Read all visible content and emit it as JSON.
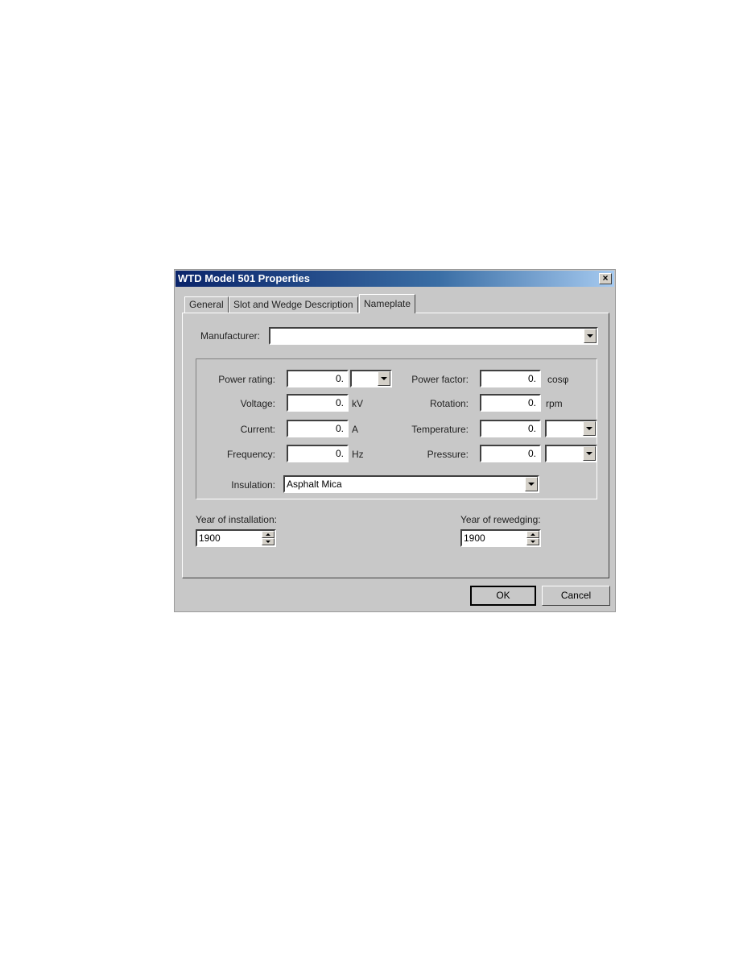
{
  "dialog": {
    "title": "WTD Model 501 Properties",
    "close_icon": "close-icon"
  },
  "tabs": [
    {
      "label": "General",
      "active": false
    },
    {
      "label": "Slot and Wedge Description",
      "active": false
    },
    {
      "label": "Nameplate",
      "active": true
    }
  ],
  "form": {
    "manufacturer": {
      "label": "Manufacturer:",
      "value": ""
    },
    "power_rating": {
      "label": "Power rating:",
      "value": "0.",
      "unit_select": ""
    },
    "voltage": {
      "label": "Voltage:",
      "value": "0.",
      "unit": "kV"
    },
    "current": {
      "label": "Current:",
      "value": "0.",
      "unit": "A"
    },
    "frequency": {
      "label": "Frequency:",
      "value": "0.",
      "unit": "Hz"
    },
    "power_factor": {
      "label": "Power factor:",
      "value": "0.",
      "unit": "cosφ"
    },
    "rotation": {
      "label": "Rotation:",
      "value": "0.",
      "unit": "rpm"
    },
    "temperature": {
      "label": "Temperature:",
      "value": "0.",
      "unit_select": ""
    },
    "pressure": {
      "label": "Pressure:",
      "value": "0.",
      "unit_select": ""
    },
    "insulation": {
      "label": "Insulation:",
      "value": "Asphalt Mica"
    },
    "year_installation": {
      "label": "Year of installation:",
      "value": "1900"
    },
    "year_rewedging": {
      "label": "Year of rewedging:",
      "value": "1900"
    }
  },
  "buttons": {
    "ok": "OK",
    "cancel": "Cancel"
  }
}
